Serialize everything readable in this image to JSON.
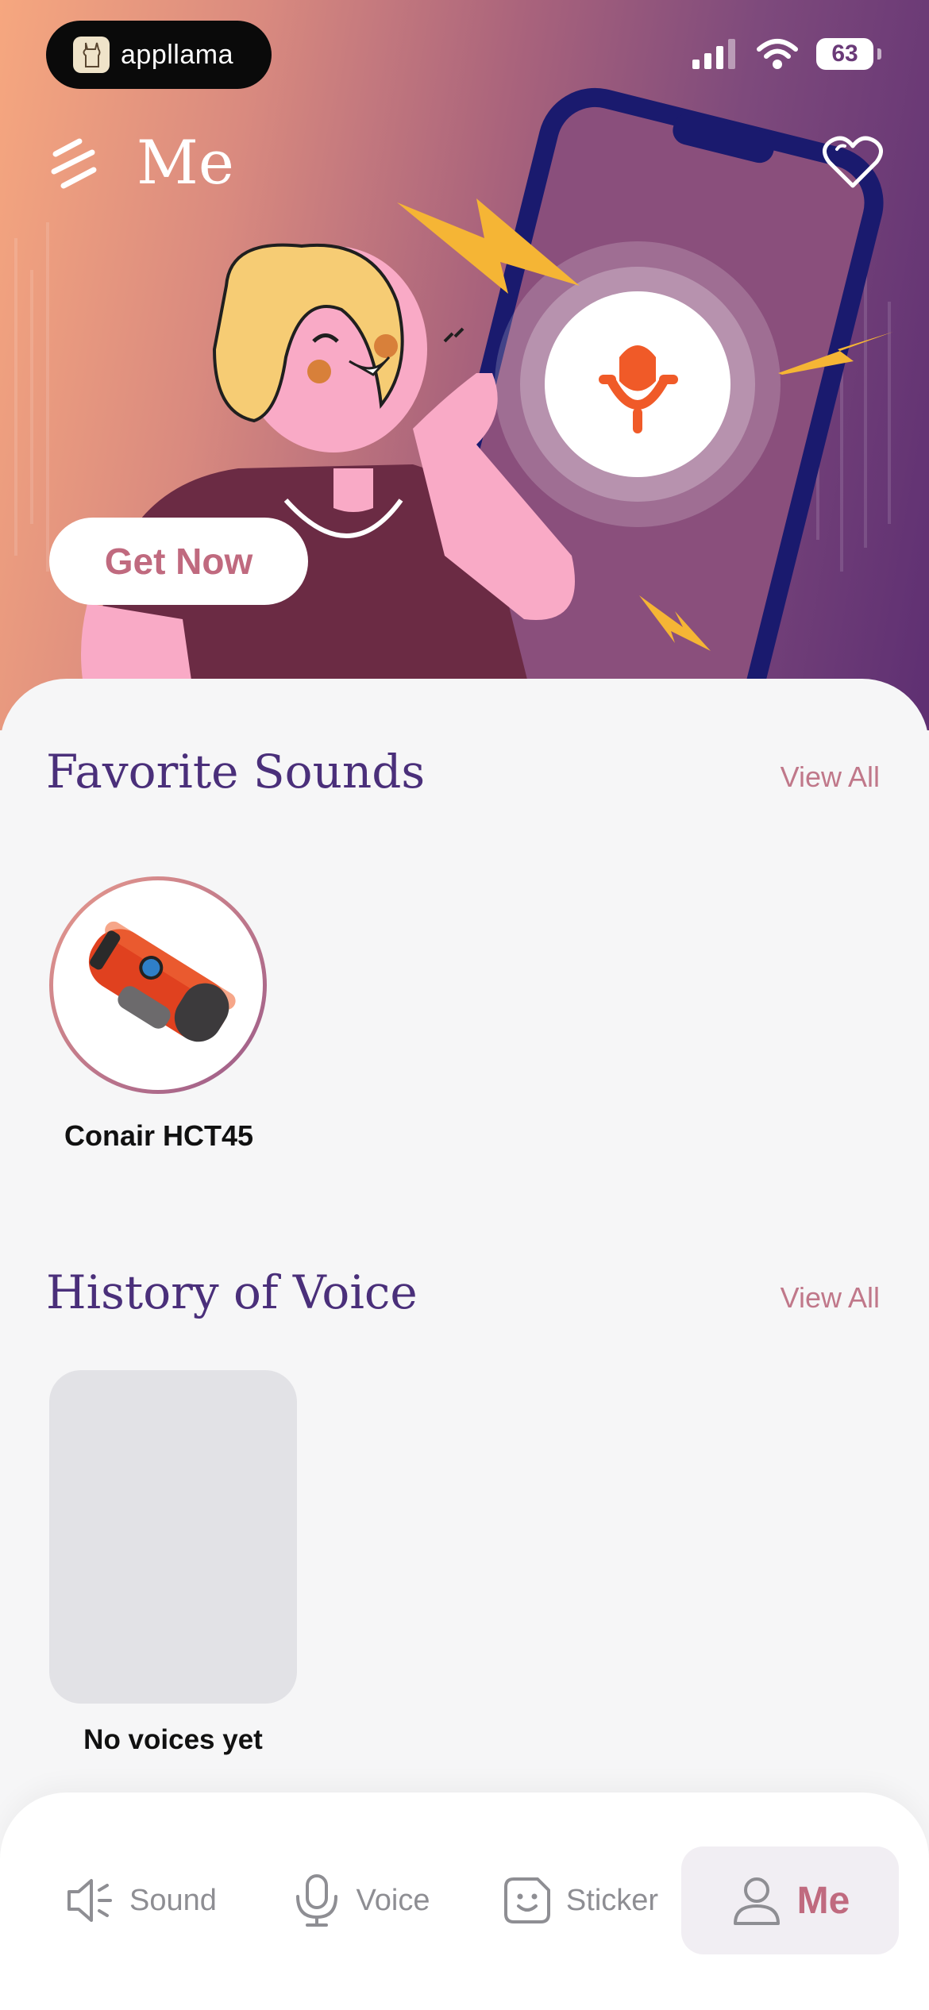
{
  "status_bar": {
    "app_badge": "appllama",
    "battery": "63"
  },
  "header": {
    "title": "Me"
  },
  "hero": {
    "cta_label": "Get Now"
  },
  "favorites": {
    "title": "Favorite Sounds",
    "view_all": "View All",
    "items": [
      {
        "label": "Conair HCT45"
      }
    ]
  },
  "history": {
    "title": "History of Voice",
    "view_all": "View All",
    "empty_label": "No voices yet"
  },
  "tabbar": {
    "tabs": [
      {
        "label": "Sound",
        "icon": "speaker-icon"
      },
      {
        "label": "Voice",
        "icon": "microphone-icon"
      },
      {
        "label": "Sticker",
        "icon": "sticker-face-icon"
      },
      {
        "label": "Me",
        "icon": "person-icon",
        "active": true
      }
    ]
  },
  "colors": {
    "accent": "#c06a7f",
    "section_title": "#4a2f7a",
    "hero_left": "#f6a77f",
    "hero_right": "#5e2f72"
  }
}
